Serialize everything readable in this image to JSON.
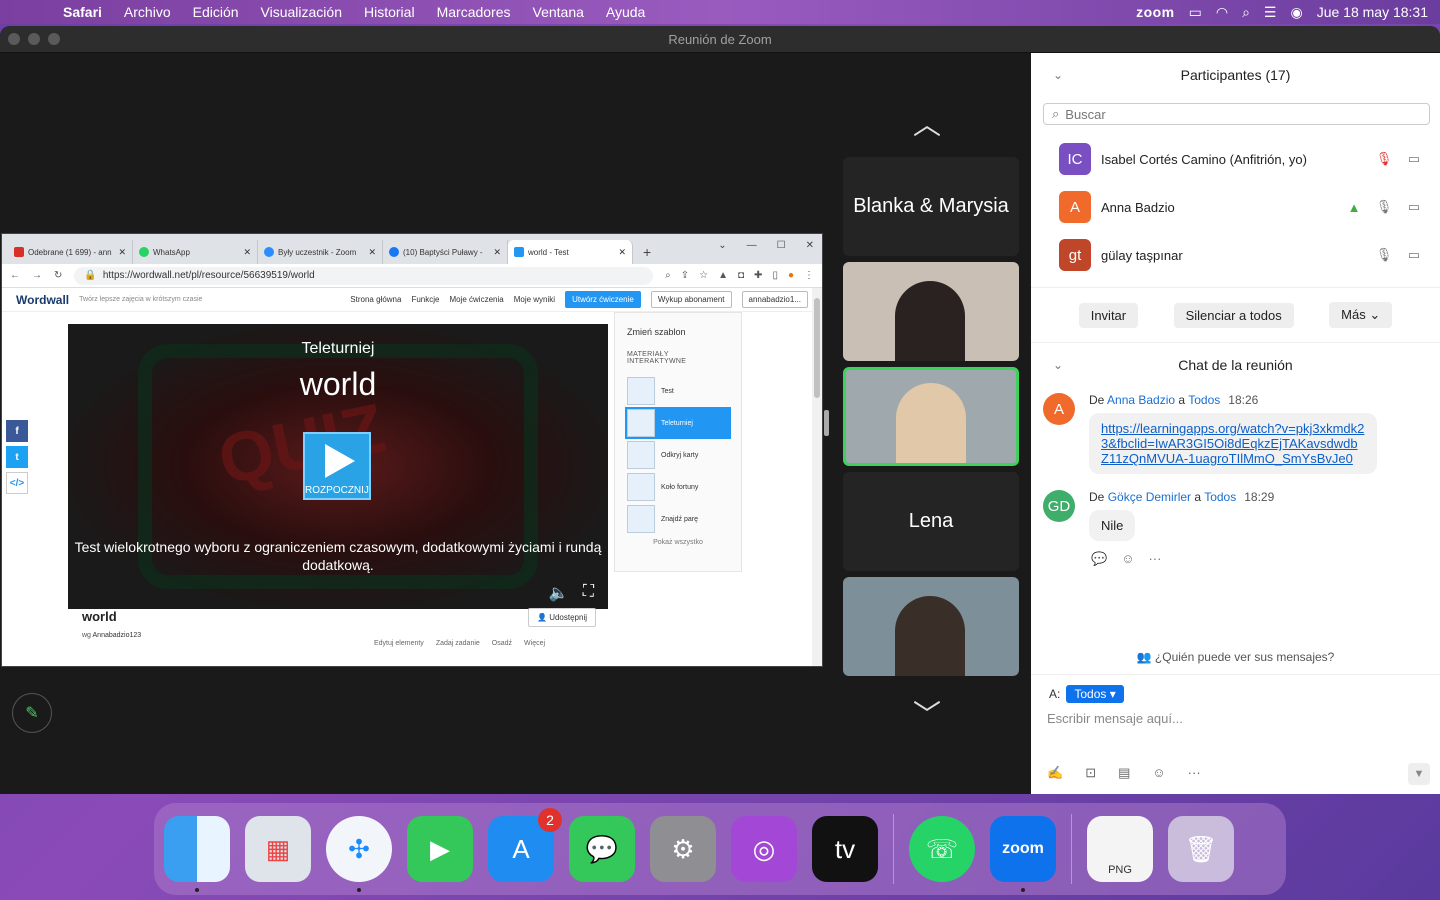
{
  "menubar": {
    "app": "Safari",
    "items": [
      "Archivo",
      "Edición",
      "Visualización",
      "Historial",
      "Marcadores",
      "Ventana",
      "Ayuda"
    ],
    "zoom_label": "zoom",
    "datetime": "Jue 18 may  18:31"
  },
  "window": {
    "title": "Reunión de Zoom"
  },
  "browser": {
    "tabs": [
      {
        "label": "Odebrane (1 699) - ann",
        "color": "#d93025"
      },
      {
        "label": "WhatsApp",
        "color": "#25d366"
      },
      {
        "label": "Były uczestnik - Zoom",
        "color": "#2d8cff"
      },
      {
        "label": "(10) Baptyści Puławy -",
        "color": "#1877f2"
      },
      {
        "label": "world - Test",
        "color": "#2196f3"
      }
    ],
    "url": "https://wordwall.net/pl/resource/56639519/world"
  },
  "wordwall": {
    "logo": "Wordwall",
    "slogan": "Twórz lepsze zajęcia w krótszym czasie",
    "nav": [
      "Strona główna",
      "Funkcje",
      "Moje ćwiczenia",
      "Moje wyniki"
    ],
    "create": "Utwórz ćwiczenie",
    "subscribe": "Wykup abonament",
    "user": "annabadzio1...",
    "game_type": "Teleturniej",
    "game_title": "world",
    "bg_word": "QUIZ",
    "play_label": "ROZPOCZNIJ",
    "description": "Test wielokrotnego wyboru z ograniczeniem czasowym, dodatkowymi życiami i rundą dodatkową.",
    "template_heading": "Zmień szablon",
    "template_sub": "MATERIAŁY INTERAKTYWNE",
    "templates": [
      "Test",
      "Teleturniej",
      "Odkryj karty",
      "Koło fortuny",
      "Znajdź parę"
    ],
    "show_all": "Pokaż wszystko",
    "title": "world",
    "by_prefix": "wg",
    "author": "Annabadzio123",
    "share": "Udostępnij",
    "actions": [
      "Edytuj elementy",
      "Zadaj zadanie",
      "Osadź",
      "Więcej"
    ]
  },
  "video": {
    "tile1": "Blanka & Marysia",
    "tile4": "Lena"
  },
  "participants": {
    "heading": "Participantes (17)",
    "search_placeholder": "Buscar",
    "list": [
      {
        "initials": "IC",
        "name": "Isabel Cortés Camino (Anfitrión, yo)",
        "color": "#7a4fc2"
      },
      {
        "initials": "A",
        "name": "Anna Badzio",
        "color": "#f06a2b"
      },
      {
        "initials": "gt",
        "name": "gülay taşpınar",
        "color": "#c0462a"
      }
    ],
    "invite": "Invitar",
    "mute_all": "Silenciar a todos",
    "more": "Más"
  },
  "chat": {
    "heading": "Chat de la reunión",
    "messages": [
      {
        "initials": "A",
        "from_label": "De",
        "name": "Anna Badzio",
        "to_label": "a",
        "to": "Todos",
        "time": "18:26",
        "text": "https://learningapps.org/watch?v=pkj3xkmdk23&fbclid=IwAR3GI5Oi8dEqkzEjTAKavsdwdbZ11zQnMVUA-1uagroTIlMmO_SmYsBvJe0",
        "color": "#f06a2b"
      },
      {
        "initials": "GD",
        "from_label": "De",
        "name": "Gökçe Demirler",
        "to_label": "a",
        "to": "Todos",
        "time": "18:29",
        "text": "Nile",
        "color": "#3fae6a"
      }
    ],
    "who_can_see": "¿Quién puede ver sus mensajes?",
    "to_label": "A:",
    "to_value": "Todos",
    "placeholder": "Escribir mensaje aquí..."
  },
  "dock": {
    "appstore_badge": "2",
    "png_label": "PNG",
    "zoom_label": "zoom"
  }
}
